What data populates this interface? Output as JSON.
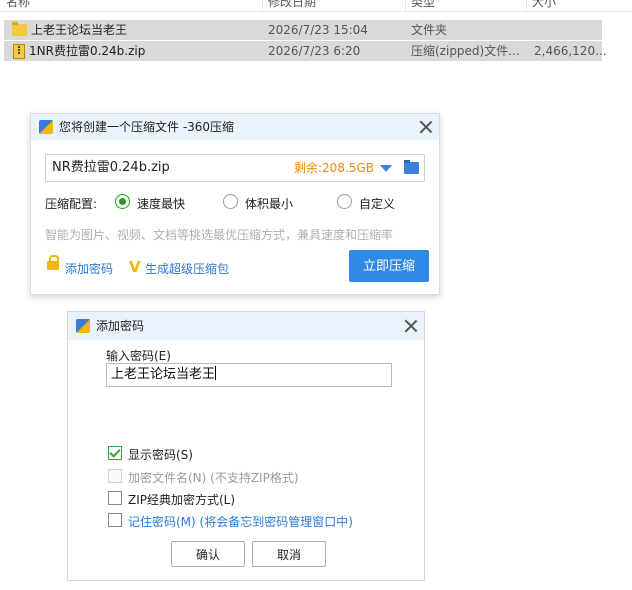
{
  "explorer": {
    "columns": {
      "name": "名称",
      "modified": "修改日期",
      "type": "类型",
      "size": "大小"
    },
    "rows": [
      {
        "name": "上老王论坛当老王",
        "modified": "2026/7/23 15:04",
        "type": "文件夹",
        "size": "",
        "icon": "folder-icon"
      },
      {
        "name": "1NR费拉雷0.24b.zip",
        "modified": "2026/7/23 6:20",
        "type": "压缩(zipped)文件...",
        "size": "2,466,120...",
        "icon": "zip-file-icon"
      }
    ]
  },
  "compress_dialog": {
    "title": "您将创建一个压缩文件 -360压缩",
    "path": "NR费拉雷0.24b.zip",
    "free_space": "剩余:208.5GB",
    "config_label": "压缩配置:",
    "options": [
      {
        "label": "速度最快",
        "checked": true
      },
      {
        "label": "体积最小",
        "checked": false
      },
      {
        "label": "自定义",
        "checked": false
      }
    ],
    "hint": "智能为图片、视频、文档等挑选最优压缩方式，兼具速度和压缩率",
    "add_password_link": "添加密码",
    "super_package_link": "生成超级压缩包",
    "compress_button": "立即压缩",
    "accent_color": "#2f8ae5"
  },
  "password_dialog": {
    "title": "添加密码",
    "input_label": "输入密码(E)",
    "input_value": "上老王论坛当老王",
    "checkboxes": [
      {
        "label": "显示密码(S)",
        "checked": true,
        "disabled": false,
        "style": "normal"
      },
      {
        "label": "加密文件名(N) (不支持ZIP格式)",
        "checked": false,
        "disabled": true,
        "style": "disabled"
      },
      {
        "label": "ZIP经典加密方式(L)",
        "checked": false,
        "disabled": false,
        "style": "normal"
      },
      {
        "label": "记住密码(M) (将会备忘到密码管理窗口中)",
        "checked": false,
        "disabled": false,
        "style": "blue"
      }
    ],
    "ok_button": "确认",
    "cancel_button": "取消"
  }
}
